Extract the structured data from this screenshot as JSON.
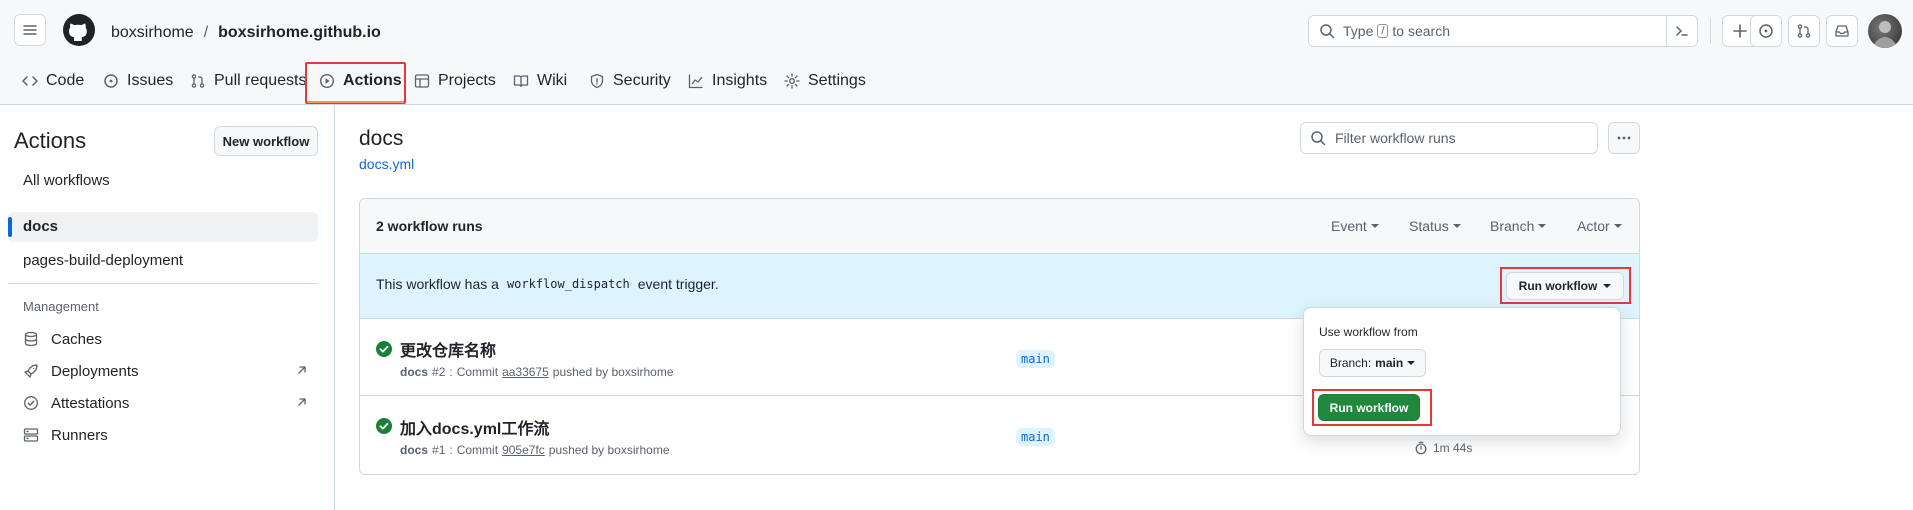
{
  "header": {
    "owner": "boxsirhome",
    "separator": "/",
    "repo": "boxsirhome.github.io",
    "search_placeholder_prefix": "Type",
    "search_key": "/",
    "search_placeholder_suffix": "to search"
  },
  "tabs": [
    {
      "label": "Code",
      "icon": "code-icon"
    },
    {
      "label": "Issues",
      "icon": "issue-icon"
    },
    {
      "label": "Pull requests",
      "icon": "pull-request-icon"
    },
    {
      "label": "Actions",
      "icon": "play-icon",
      "selected": true
    },
    {
      "label": "Projects",
      "icon": "table-icon"
    },
    {
      "label": "Wiki",
      "icon": "book-icon"
    },
    {
      "label": "Security",
      "icon": "shield-icon"
    },
    {
      "label": "Insights",
      "icon": "graph-icon"
    },
    {
      "label": "Settings",
      "icon": "gear-icon"
    }
  ],
  "sidebar": {
    "title": "Actions",
    "new_workflow": "New workflow",
    "all_workflows": "All workflows",
    "workflows": [
      "docs",
      "pages-build-deployment"
    ],
    "management_title": "Management",
    "management": [
      {
        "label": "Caches",
        "icon": "cache-icon"
      },
      {
        "label": "Deployments",
        "icon": "rocket-icon"
      },
      {
        "label": "Attestations",
        "icon": "verified-icon"
      },
      {
        "label": "Runners",
        "icon": "server-icon"
      }
    ]
  },
  "main": {
    "title": "docs",
    "file": "docs.yml",
    "filter_placeholder": "Filter workflow runs",
    "runs_count": "2 workflow runs",
    "filters": [
      "Event",
      "Status",
      "Branch",
      "Actor"
    ],
    "dispatch_prefix": "This workflow has a",
    "dispatch_code": "workflow_dispatch",
    "dispatch_suffix": "event trigger.",
    "run_workflow_button": "Run workflow",
    "runs": [
      {
        "title": "更改仓库名称",
        "workflow": "docs",
        "number": "#2",
        "commit_label": "Commit",
        "commit": "aa33675",
        "pushed_by": "pushed by boxsirhome",
        "branch": "main",
        "duration": ""
      },
      {
        "title": "加入docs.yml工作流",
        "workflow": "docs",
        "number": "#1",
        "commit_label": "Commit",
        "commit": "905e7fc",
        "pushed_by": "pushed by boxsirhome",
        "branch": "main",
        "duration": "1m 44s"
      }
    ]
  },
  "popup": {
    "label": "Use workflow from",
    "branch_prefix": "Branch:",
    "branch": "main",
    "run_button": "Run workflow"
  },
  "colors": {
    "accent": "#0969da",
    "success": "#1a7f37",
    "highlight": "#e5383b",
    "dispatch_bg": "#ddf4ff"
  }
}
